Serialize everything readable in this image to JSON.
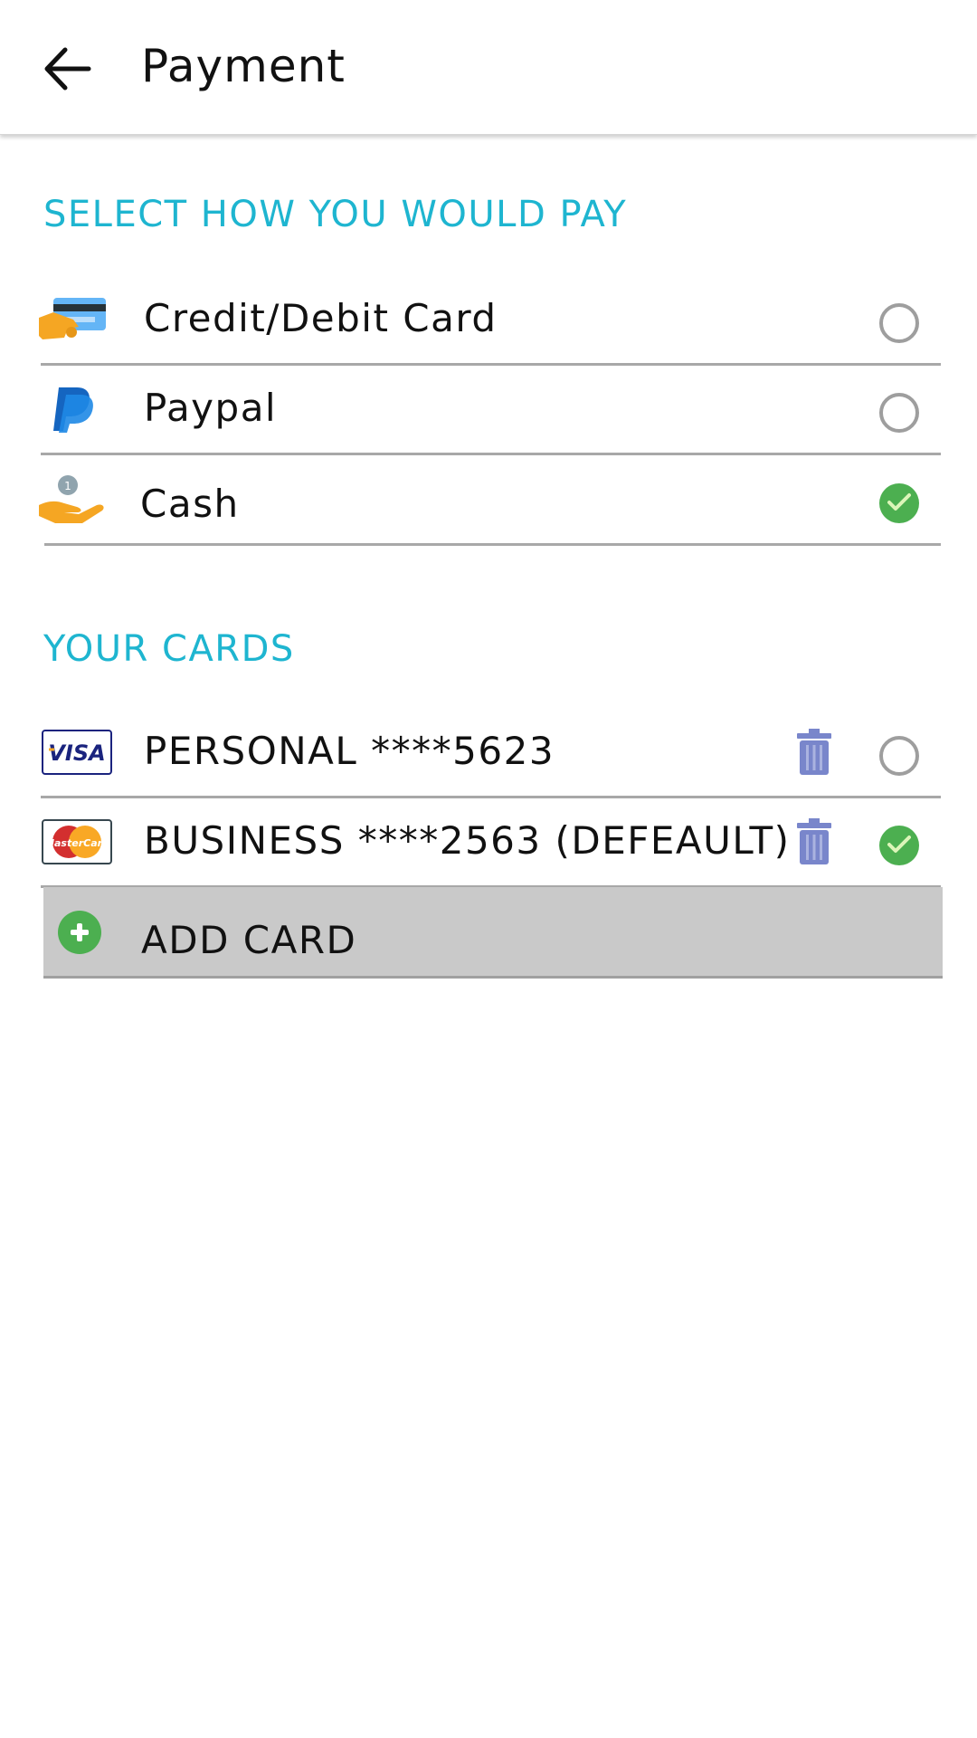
{
  "header": {
    "title": "Payment",
    "back_icon": "arrow-left-icon"
  },
  "payment_methods": {
    "heading": "SELECT HOW YOU WOULD PAY",
    "options": [
      {
        "label": "Credit/Debit Card",
        "icon": "credit-card-hand-icon",
        "selected": false
      },
      {
        "label": "Paypal",
        "icon": "paypal-icon",
        "selected": false
      },
      {
        "label": "Cash",
        "icon": "cash-hand-icon",
        "selected": true
      }
    ]
  },
  "cards": {
    "heading": "YOUR CARDS",
    "items": [
      {
        "label": "PERSONAL ****5623",
        "brand": "VISA",
        "icon": "visa-icon",
        "selected": false
      },
      {
        "label": "BUSINESS ****2563 (DEFEAULT)",
        "brand": "MasterCard",
        "icon": "mastercard-icon",
        "selected": true
      }
    ],
    "add_label": "ADD CARD"
  },
  "colors": {
    "accent": "#1eb5d0",
    "selected": "#4caf50",
    "trash": "#7986cb",
    "add_bg": "#c9c9c9"
  }
}
